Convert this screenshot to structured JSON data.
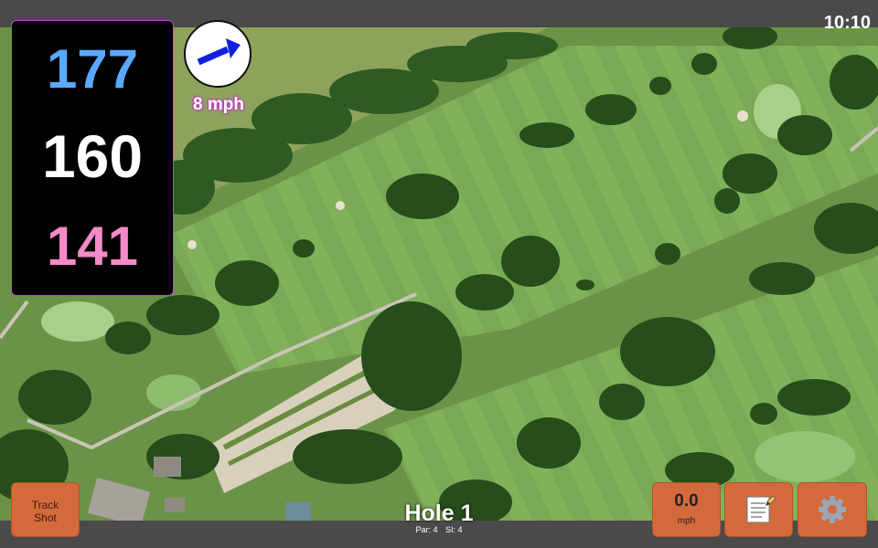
{
  "status": {
    "time": "10:10"
  },
  "distances": {
    "back": "177",
    "center": "160",
    "front": "141"
  },
  "wind": {
    "speed": "8 mph",
    "icon": "wind-arrow-icon"
  },
  "buttons": {
    "track_shot_line1": "Track",
    "track_shot_line2": "Shot",
    "speed_value": "0.0",
    "speed_unit": "mph",
    "notes_icon": "notepad-icon",
    "settings_icon": "gear-icon"
  },
  "hole": {
    "title": "Hole 1",
    "par": "Par: 4",
    "si": "SI: 4"
  },
  "colors": {
    "back": "#5aa9ff",
    "center": "#ffffff",
    "front": "#f48ac8",
    "button": "#d46a3c",
    "panel_border": "#c04bd0",
    "bar": "#4a4a4a"
  }
}
